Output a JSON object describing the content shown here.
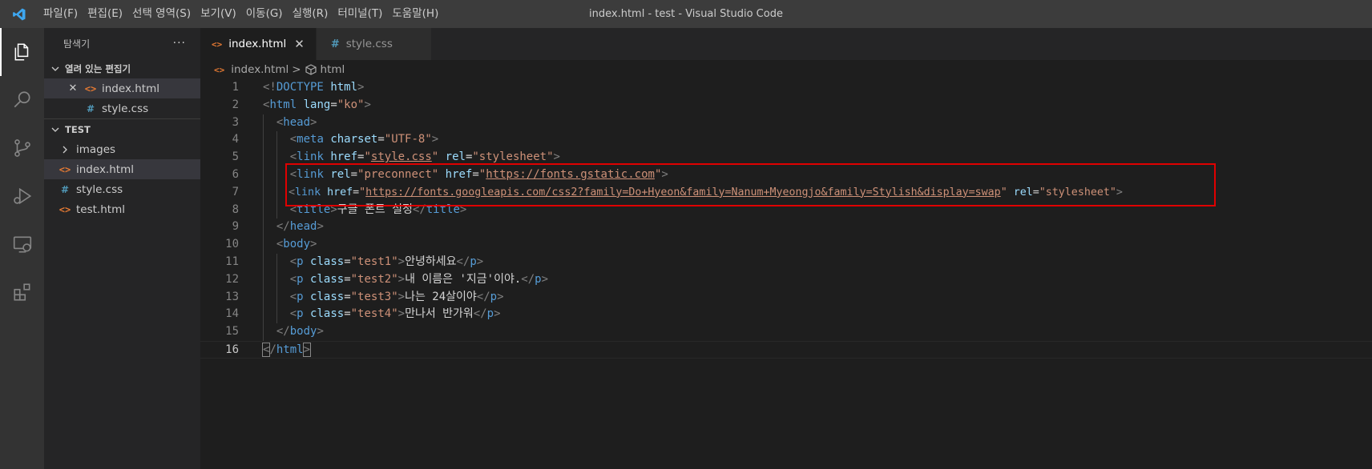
{
  "window": {
    "title": "index.html - test - Visual Studio Code"
  },
  "menu": [
    "파일(F)",
    "편집(E)",
    "선택 영역(S)",
    "보기(V)",
    "이동(G)",
    "실행(R)",
    "터미널(T)",
    "도움말(H)"
  ],
  "sidebar": {
    "title": "탐색기",
    "more": "···",
    "open_editors_label": "열려 있는 편집기",
    "open_editors": [
      {
        "name": "index.html",
        "icon": "html-file-icon",
        "icon_text": "<>",
        "close": "✕"
      },
      {
        "name": "style.css",
        "icon": "css-file-icon",
        "icon_text": "#"
      }
    ],
    "folder_label": "TEST",
    "files": [
      {
        "name": "images",
        "icon": "chevron-right-icon",
        "icon_text": "›"
      },
      {
        "name": "index.html",
        "icon": "html-file-icon",
        "icon_text": "<>"
      },
      {
        "name": "style.css",
        "icon": "css-file-icon",
        "icon_text": "#"
      },
      {
        "name": "test.html",
        "icon": "html-file-icon",
        "icon_text": "<>"
      }
    ]
  },
  "tabs": [
    {
      "label": "index.html",
      "icon_text": "<>",
      "close": "✕",
      "active": true
    },
    {
      "label": "style.css",
      "icon_text": "#",
      "active": false
    }
  ],
  "breadcrumb": {
    "file": "index.html",
    "sep": ">",
    "symbol": "html"
  },
  "editor": {
    "line_numbers": [
      "1",
      "2",
      "3",
      "4",
      "5",
      "6",
      "7",
      "8",
      "9",
      "10",
      "11",
      "12",
      "13",
      "14",
      "15",
      "16"
    ],
    "current_line": "16",
    "highlighted_lines": [
      "6",
      "7"
    ]
  },
  "colors": {
    "tag": "#569cd6",
    "attribute": "#9cdcfe",
    "string": "#ce9178",
    "punctuation": "#808080",
    "highlight_box": "#e00000",
    "html_icon": "#e37933",
    "css_icon": "#519aba"
  }
}
